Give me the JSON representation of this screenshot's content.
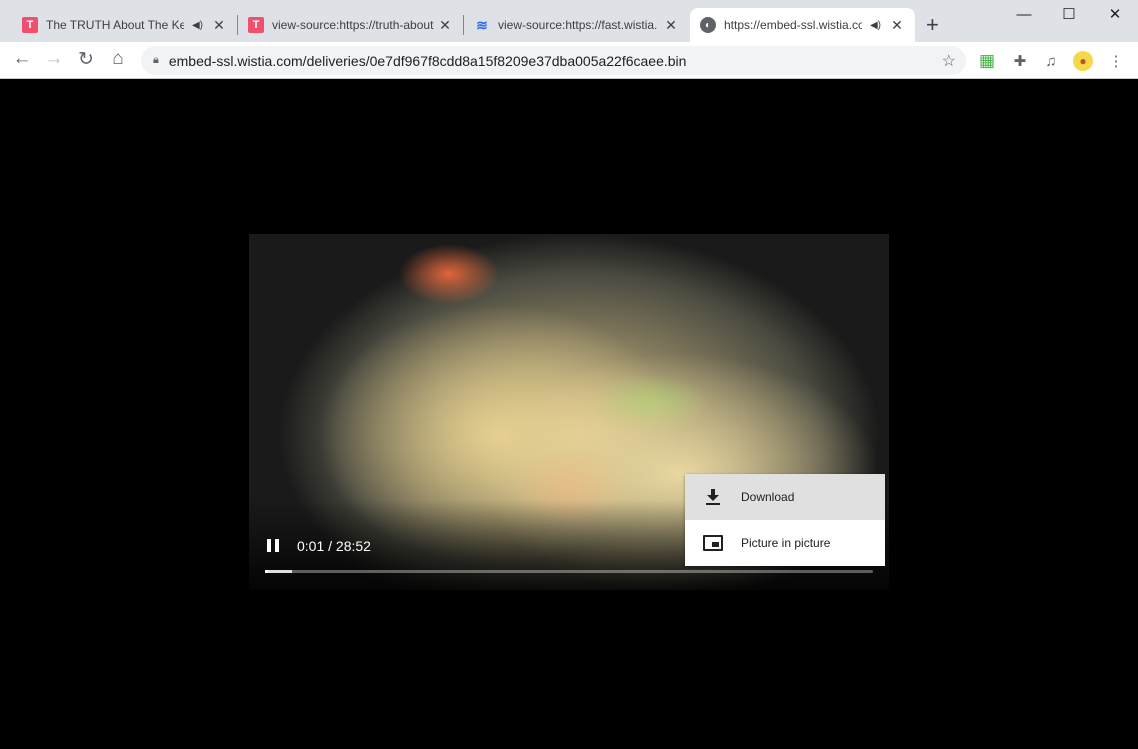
{
  "tabs": [
    {
      "title": "The TRUTH About The Keto",
      "favicon": "T",
      "favicon_color": "#f0506e",
      "audio": true
    },
    {
      "title": "view-source:https://truth-about",
      "favicon": "T",
      "favicon_color": "#f0506e",
      "audio": false
    },
    {
      "title": "view-source:https://fast.wistia.",
      "favicon": "wistia-icon",
      "favicon_color": "#2c6df2",
      "audio": false
    },
    {
      "title": "https://embed-ssl.wistia.com",
      "favicon": "globe-icon",
      "audio": true,
      "active": true
    }
  ],
  "address": {
    "url": "embed-ssl.wistia.com/deliveries/0e7df967f8cdd8a15f8209e37dba005a22f6caee.bin"
  },
  "player": {
    "time": "0:01 / 28:52",
    "played_fraction": 0.0006,
    "buffered_fraction": 0.044,
    "state": "playing"
  },
  "menu": {
    "items": [
      {
        "label": "Download",
        "icon": "download-icon",
        "highlighted": true
      },
      {
        "label": "Picture in picture",
        "icon": "picture-in-picture-icon"
      }
    ]
  }
}
